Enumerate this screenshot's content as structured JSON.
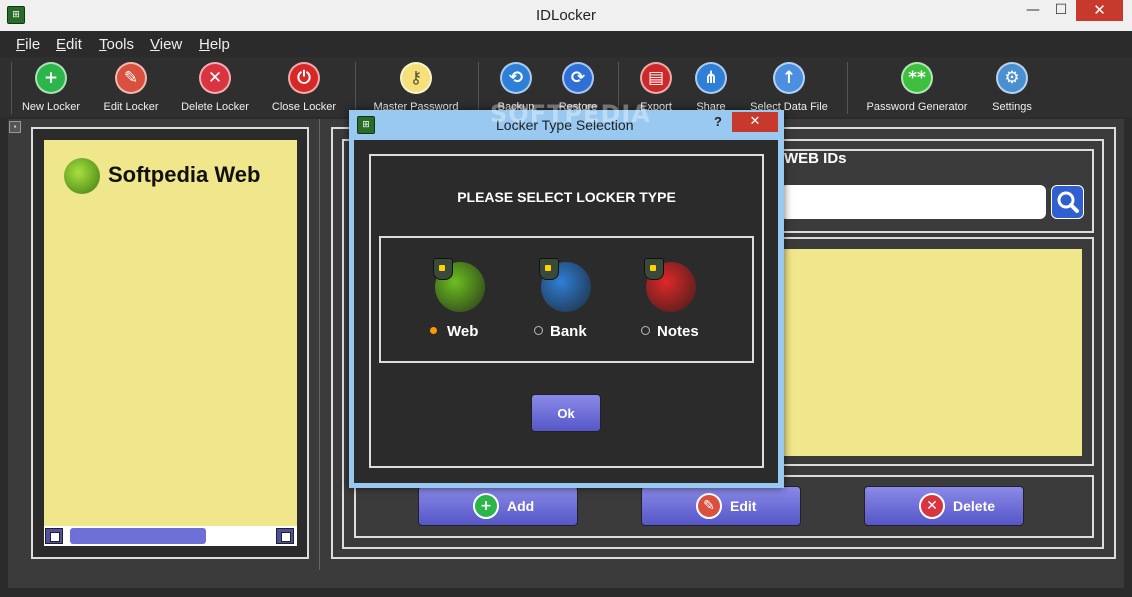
{
  "window": {
    "title": "IDLocker",
    "min_glyph": "—",
    "max_glyph": "☐",
    "close_glyph": "✕",
    "app_icon_glyph": "⊞"
  },
  "menu": [
    {
      "label": "File"
    },
    {
      "label": "Edit"
    },
    {
      "label": "Tools"
    },
    {
      "label": "View"
    },
    {
      "label": "Help"
    }
  ],
  "toolbar": [
    {
      "label": "New Locker",
      "icon": "plus-icon",
      "glyph": "+",
      "color": "#2bb54a"
    },
    {
      "label": "Edit Locker",
      "icon": "pencil-icon",
      "glyph": "✎",
      "color": "#d9503f"
    },
    {
      "label": "Delete Locker",
      "icon": "x-icon",
      "glyph": "✕",
      "color": "#d9343f"
    },
    {
      "label": "Close Locker",
      "icon": "power-icon",
      "glyph": "⏻",
      "color": "#d72828"
    },
    {
      "label": "Master Password",
      "icon": "key-icon",
      "glyph": "⚷",
      "color": "#f5e07a"
    },
    {
      "label": "Backup",
      "icon": "backup-icon",
      "glyph": "⟲",
      "color": "#2f7fd6"
    },
    {
      "label": "Restore",
      "icon": "restore-icon",
      "glyph": "⟳",
      "color": "#2f6fd6"
    },
    {
      "label": "Export",
      "icon": "export-icon",
      "glyph": "▤",
      "color": "#cc2a2a"
    },
    {
      "label": "Share",
      "icon": "share-icon",
      "glyph": "⋔",
      "color": "#2f7fd6"
    },
    {
      "label": "Select Data File",
      "icon": "upload-icon",
      "glyph": "↑",
      "color": "#4a8fe0"
    },
    {
      "label": "Password Generator",
      "icon": "lock-icon",
      "glyph": "**",
      "color": "#3fbf3f"
    },
    {
      "label": "Settings",
      "icon": "gear-icon",
      "glyph": "⚙",
      "color": "#4a8fd0"
    }
  ],
  "left_panel": {
    "selected_locker": "Softpedia Web"
  },
  "right_panel": {
    "heading": "WEB IDs",
    "search_value": "",
    "search_placeholder": ""
  },
  "actions": [
    {
      "label": "Add",
      "icon": "add-icon",
      "glyph": "+",
      "color": "#2bb54a"
    },
    {
      "label": "Edit",
      "icon": "edit-icon",
      "glyph": "✎",
      "color": "#d9503f"
    },
    {
      "label": "Delete",
      "icon": "delete-icon",
      "glyph": "✕",
      "color": "#d9343f"
    }
  ],
  "dialog": {
    "title": "Locker Type Selection",
    "help": "?",
    "close": "✕",
    "heading": "PLEASE SELECT LOCKER TYPE",
    "options": [
      {
        "label": "Web",
        "selected": true,
        "color": "#6cbf20"
      },
      {
        "label": "Bank",
        "selected": false,
        "color": "#2f7fd6"
      },
      {
        "label": "Notes",
        "selected": false,
        "color": "#e02828"
      }
    ],
    "ok_label": "Ok"
  },
  "watermark": "SOFTPEDIA"
}
